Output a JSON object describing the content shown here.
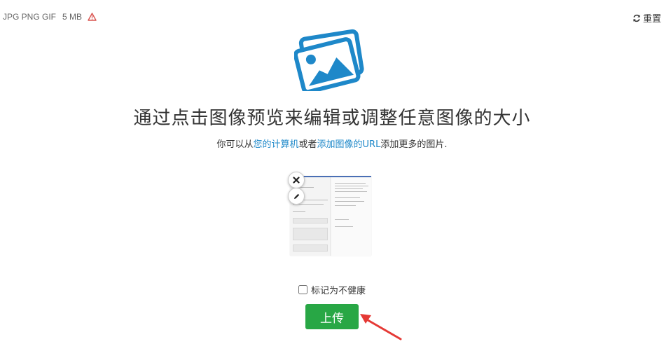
{
  "formats": {
    "types": "JPG PNG GIF",
    "size": "5 MB",
    "icon": "warning-triangle-icon"
  },
  "reset": {
    "label": "重置",
    "icon": "refresh-icon"
  },
  "hero_icon": "photos-icon",
  "headline": "通过点击图像预览来编辑或调整任意图像的大小",
  "subline": {
    "prefix": "你可以从",
    "link_computer": "您的计算机",
    "middle": "或者",
    "link_url": "添加图像的URL",
    "suffix": "添加更多的图片."
  },
  "preview": {
    "remove_icon": "close-icon",
    "edit_icon": "pencil-icon"
  },
  "checkbox": {
    "label": "标记为不健康",
    "checked": false
  },
  "upload_button": {
    "label": "上传"
  },
  "colors": {
    "accent": "#1e88c9",
    "upload": "#28a745",
    "warning": "#d9534f",
    "arrow": "#e53935"
  }
}
